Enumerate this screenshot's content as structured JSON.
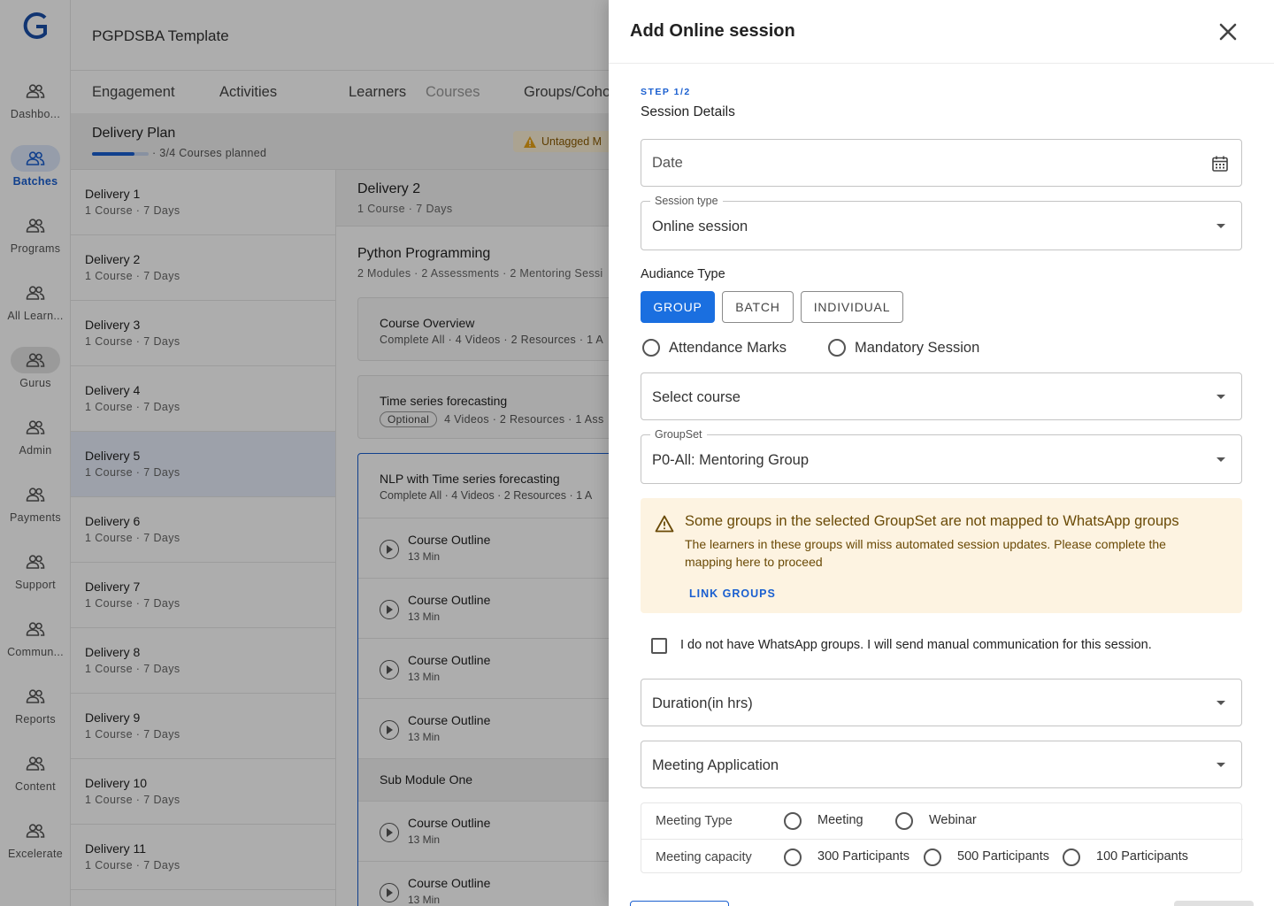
{
  "app": {
    "title": "PGPDSBA Template"
  },
  "rail": [
    {
      "label": "Dashbo...",
      "icon": "people-icon"
    },
    {
      "label": "Batches",
      "icon": "people-icon"
    },
    {
      "label": "Programs",
      "icon": "people-icon"
    },
    {
      "label": "All Learn...",
      "icon": "people-icon"
    },
    {
      "label": "Gurus",
      "icon": "people-icon"
    },
    {
      "label": "Admin",
      "icon": "people-icon"
    },
    {
      "label": "Payments",
      "icon": "people-icon"
    },
    {
      "label": "Support",
      "icon": "people-icon"
    },
    {
      "label": "Commun...",
      "icon": "people-icon"
    },
    {
      "label": "Reports",
      "icon": "people-icon"
    },
    {
      "label": "Content",
      "icon": "people-icon"
    },
    {
      "label": "Excelerate",
      "icon": "people-icon"
    }
  ],
  "tabs": [
    "Engagement",
    "Activities",
    "Learners",
    "Courses",
    "Groups/Coho"
  ],
  "plan": {
    "title": "Delivery Plan",
    "progress_text": "· 3/4 Courses planned",
    "progress": 0.75,
    "untagged": "Untagged M"
  },
  "deliveries": [
    {
      "name": "Delivery 1",
      "meta": "1 Course · 7 Days"
    },
    {
      "name": "Delivery 2",
      "meta": "1 Course · 7 Days"
    },
    {
      "name": "Delivery 3",
      "meta": "1 Course · 7 Days"
    },
    {
      "name": "Delivery 4",
      "meta": "1 Course · 7 Days"
    },
    {
      "name": "Delivery 5",
      "meta": "1 Course · 7 Days"
    },
    {
      "name": "Delivery 6",
      "meta": "1 Course · 7 Days"
    },
    {
      "name": "Delivery 7",
      "meta": "1 Course · 7 Days"
    },
    {
      "name": "Delivery 8",
      "meta": "1 Course · 7 Days"
    },
    {
      "name": "Delivery 9",
      "meta": "1 Course · 7 Days"
    },
    {
      "name": "Delivery 10",
      "meta": "1 Course · 7 Days"
    },
    {
      "name": "Delivery 11",
      "meta": "1 Course · 7 Days"
    }
  ],
  "detail": {
    "title": "Delivery 2",
    "meta": "1 Course · 7 Days",
    "course": "Python Programming",
    "course_meta": "2 Modules · 2 Assessments · 2 Mentoring Sessi",
    "overview": {
      "title": "Course Overview",
      "meta": "Complete All · 4 Videos  · 2 Resources · 1 A"
    },
    "ts": {
      "title": "Time series forecasting",
      "chip": "Optional",
      "meta": "4 Videos  · 2 Resources · 1 Ass"
    },
    "nlp": {
      "title": "NLP with Time series forecasting",
      "meta": "Complete All · 4 Videos  · 2 Resources · 1 A"
    },
    "outline": {
      "title": "Course Outline",
      "dur": "13 Min"
    },
    "submodule": "Sub Module One"
  },
  "drawer": {
    "title": "Add Online session",
    "step": "STEP 1/2",
    "section": "Session Details",
    "date_placeholder": "Date",
    "session_type_label": "Session type",
    "session_type_value": "Online session",
    "audience_label": "Audiance Type",
    "audience_buttons": [
      "GROUP",
      "BATCH",
      "INDIVIDUAL"
    ],
    "attendance": "Attendance Marks",
    "mandatory": "Mandatory Session",
    "select_course": "Select course",
    "groupset_label": "GroupSet",
    "groupset_value": "P0-All: Mentoring Group",
    "warning_title": "Some groups in the selected GroupSet are not mapped to WhatsApp groups",
    "warning_desc": "The learners in these groups will miss automated session updates. Please complete the mapping here to proceed",
    "warning_link": "LINK GROUPS",
    "checkbox_label": "I do not have WhatsApp groups. I will send manual communication for this session.",
    "duration": "Duration(in hrs)",
    "meeting_app": "Meeting Application",
    "meeting_type_label": "Meeting Type",
    "meeting_types": [
      "Meeting",
      "Webinar"
    ],
    "capacity_label": "Meeting capacity",
    "capacities": [
      "300 Participants",
      "500 Participants",
      "100 Participants"
    ]
  },
  "colors": {
    "accent": "#1a6fe0",
    "warning_bg": "#fdf3e1",
    "warning_text": "#6a4a06"
  }
}
